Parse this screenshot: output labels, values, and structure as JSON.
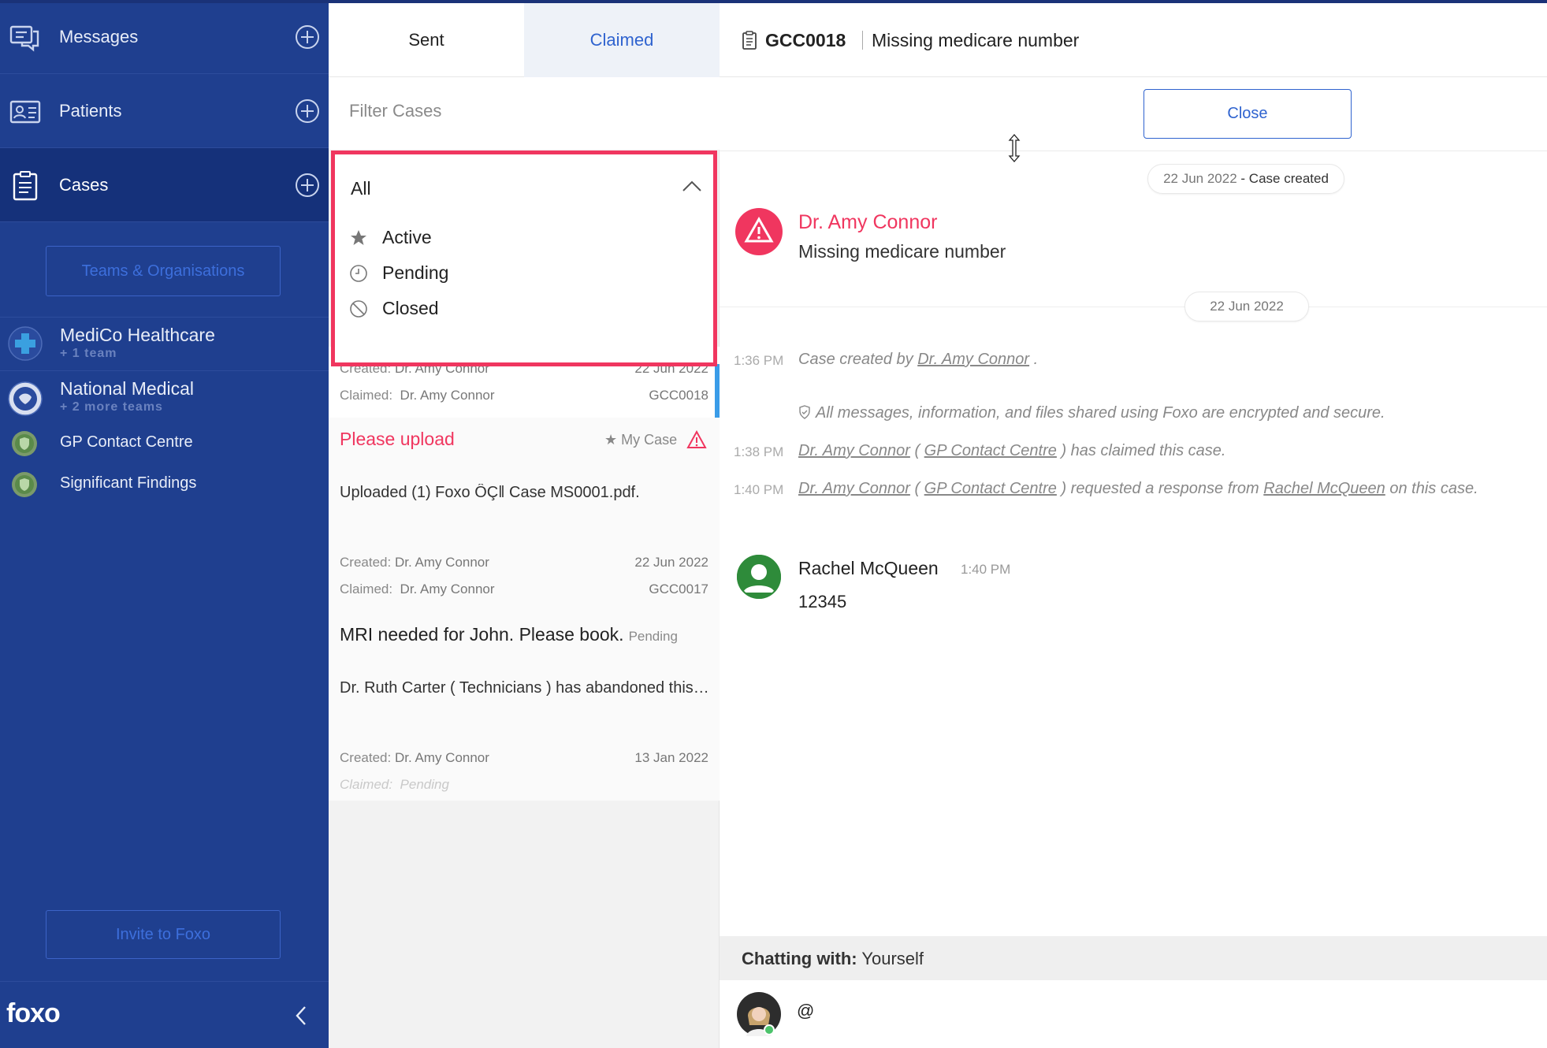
{
  "sidebar": {
    "nav": [
      {
        "label": "Messages",
        "icon": "messages-icon"
      },
      {
        "label": "Patients",
        "icon": "patients-icon"
      },
      {
        "label": "Cases",
        "icon": "cases-icon",
        "active": true
      }
    ],
    "teams_button": "Teams & Organisations",
    "orgs": [
      {
        "name": "MediCo Healthcare",
        "sub": "+ 1 team"
      },
      {
        "name": "National Medical",
        "sub": "+ 2 more teams"
      }
    ],
    "teams": [
      {
        "name": "GP Contact Centre"
      },
      {
        "name": "Significant Findings"
      }
    ],
    "invite_button": "Invite to Foxo",
    "logo": "foxo"
  },
  "middle": {
    "tabs": [
      {
        "label": "Sent",
        "active": false
      },
      {
        "label": "Claimed",
        "active": true
      }
    ],
    "filter_placeholder": "Filter Cases",
    "dropdown": {
      "selected": "All",
      "options": [
        {
          "label": "Active",
          "icon": "star-icon"
        },
        {
          "label": "Pending",
          "icon": "clock-icon"
        },
        {
          "label": "Closed",
          "icon": "blocked-icon"
        }
      ]
    },
    "cards": [
      {
        "created_label": "Created:",
        "created_by": "Dr. Amy Connor",
        "date": "22 Jun 2022",
        "claimed_label": "Claimed:",
        "claimed_by": "Dr. Amy Connor",
        "case_id": "GCC0018"
      },
      {
        "title": "Please upload",
        "tag": "My Case",
        "preview": "Uploaded (1) Foxo ÔÇ‖ Case MS0001.pdf.",
        "created_label": "Created:",
        "created_by": "Dr. Amy Connor",
        "date": "22 Jun 2022",
        "claimed_label": "Claimed:",
        "claimed_by": "Dr. Amy Connor",
        "case_id": "GCC0017"
      },
      {
        "title": "MRI needed for John. Please book.",
        "status": "Pending",
        "preview": "Dr. Ruth Carter ( Technicians ) has abandoned this case.",
        "created_label": "Created:",
        "created_by": "Dr. Amy Connor",
        "date": "13 Jan 2022",
        "claimed_label": "Claimed:",
        "claimed_by": "Pending"
      }
    ]
  },
  "case": {
    "id": "GCC0018",
    "title": "Missing medicare number",
    "close_button": "Close",
    "created_pill": {
      "date": "22 Jun 2022",
      "text": "- Case created"
    },
    "alert": {
      "name": "Dr. Amy Connor",
      "message": "Missing medicare number"
    },
    "date_pill": "22 Jun 2022",
    "log": [
      {
        "time": "1:36 PM",
        "pre": "Case created by ",
        "link1": "Dr. Amy Connor",
        "post": " ."
      },
      {
        "time": "",
        "text": "All messages, information, and files shared using Foxo are encrypted and secure."
      },
      {
        "time": "1:38 PM",
        "link1": "Dr. Amy Connor",
        "mid1": " ( ",
        "link2": "GP Contact Centre",
        "post": " ) has claimed this case."
      },
      {
        "time": "1:40 PM",
        "link1": "Dr. Amy Connor",
        "mid1": " ( ",
        "link2": "GP Contact Centre",
        "mid2": " ) requested a response from ",
        "link3": "Rachel McQueen",
        "post": " on this case."
      }
    ],
    "message": {
      "author": "Rachel McQueen",
      "time": "1:40 PM",
      "body": "12345"
    },
    "chatting_label": "Chatting with:",
    "chatting_with": "Yourself",
    "compose_value": "@"
  },
  "colors": {
    "sidebar": "#1f3f8f",
    "sidebar_active": "#15317a",
    "accent_blue": "#2f63cf",
    "alert_red": "#f0365f",
    "selection_blue": "#3a9ce8"
  }
}
